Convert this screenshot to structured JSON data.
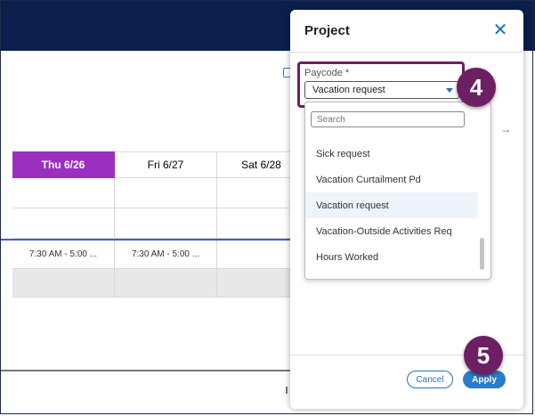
{
  "grid": {
    "headers": [
      "Thu 6/26",
      "Fri 6/27",
      "Sat 6/28"
    ],
    "shift_text": [
      "7:30 AM - 5:00 ...",
      "7:30 AM - 5:00 ..."
    ]
  },
  "panel": {
    "title": "Project",
    "close_icon": "close-icon",
    "paycode_label": "Paycode *",
    "selected_value": "Vacation request",
    "search_placeholder": "Search",
    "options": [
      "Sick request",
      "Vacation Curtailment Pd",
      "Vacation request",
      "Vacation-Outside Activities Req",
      "Hours Worked"
    ],
    "cancel_label": "Cancel",
    "apply_label": "Apply"
  },
  "callouts": {
    "step4": "4",
    "step5": "5"
  },
  "colors": {
    "accent": "#9b2fc0",
    "navy": "#0b1f4d",
    "callout": "#6d1f63",
    "primary": "#2a7dc8"
  }
}
